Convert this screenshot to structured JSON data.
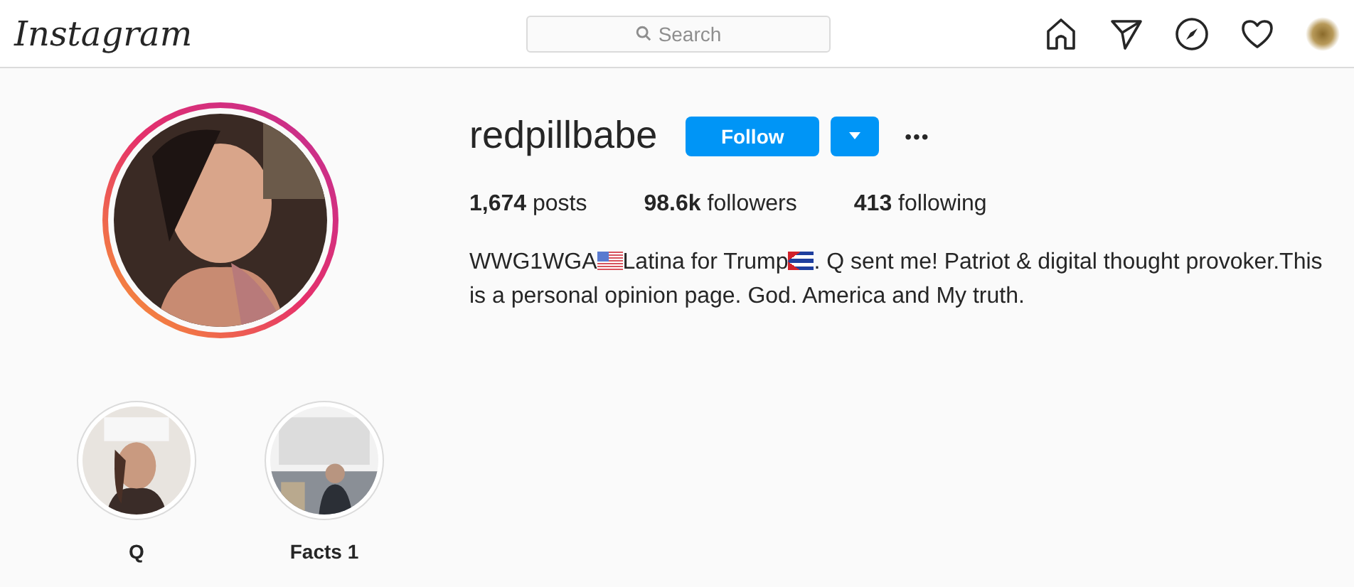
{
  "header": {
    "logo": "Instagram",
    "search": {
      "placeholder": "Search"
    }
  },
  "profile": {
    "username": "redpillbabe",
    "follow_button": "Follow",
    "more": "•••",
    "stats": [
      {
        "count": "1,674",
        "label": "posts"
      },
      {
        "count": "98.6k",
        "label": "followers"
      },
      {
        "count": "413",
        "label": "following"
      }
    ],
    "bio": [
      {
        "kind": "text",
        "text": "WWG1WGA"
      },
      {
        "kind": "usflag"
      },
      {
        "kind": "text",
        "text": "Latina for Trump"
      },
      {
        "kind": "cubaflag"
      },
      {
        "kind": "text",
        "text": ". Q sent me! Patriot & digital thought provoker.This is a personal opinion page. God. America and My truth."
      }
    ]
  },
  "highlights": [
    {
      "label": "Q",
      "kind": "picture"
    },
    {
      "label": "Facts 1",
      "kind": "picture"
    }
  ]
}
